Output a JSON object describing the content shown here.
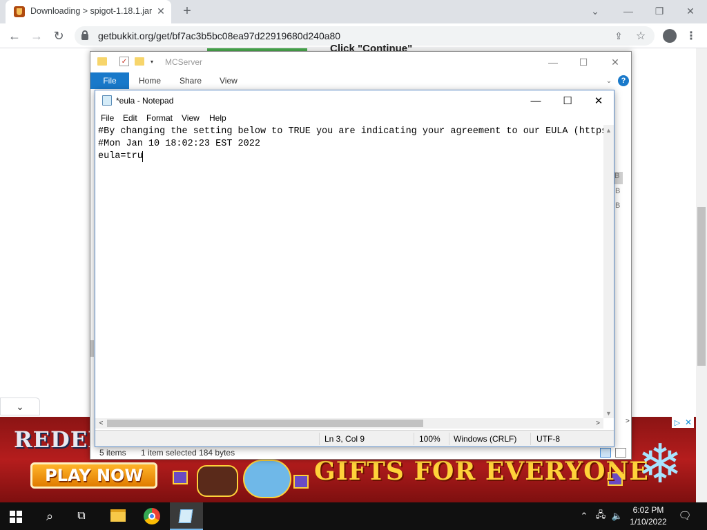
{
  "browser": {
    "tab_title": "Downloading > spigot-1.18.1.jar",
    "tab_close": "✕",
    "new_tab": "+",
    "url": "getbukkit.org/get/bf7ac3b5bc08ea97d22919680d240a80",
    "nav": {
      "back": "←",
      "forward": "→",
      "reload": "↻"
    },
    "window_controls": {
      "chevron": "⌄",
      "minimize": "—",
      "restore": "❐",
      "close": "✕"
    },
    "share": "⇪",
    "star": "☆",
    "menu": "⋮"
  },
  "page": {
    "background_text": "Click \"Continue\"",
    "download_chevron": "⌄"
  },
  "ad": {
    "brand_text": "REDEM",
    "play_now": "PLAY NOW",
    "headline": "GIFTS FOR EVERYONE",
    "snowflake": "❄",
    "choices": "▷",
    "close": "✕"
  },
  "explorer": {
    "title": "MCServer",
    "check": "✓",
    "dropdown": "▾",
    "controls": {
      "minimize": "—",
      "maximize": "☐",
      "close": "✕"
    },
    "ribbon": {
      "file": "File",
      "tabs": [
        "Home",
        "Share",
        "View"
      ],
      "chevron": "⌄",
      "help": "?"
    },
    "status": {
      "items": "5 items",
      "selected": "1 item selected  184 bytes"
    },
    "background_letters": [
      "B",
      "B",
      "B"
    ]
  },
  "notepad": {
    "title": "*eula - Notepad",
    "controls": {
      "minimize": "—",
      "maximize": "☐",
      "close": "✕"
    },
    "menu": [
      "File",
      "Edit",
      "Format",
      "View",
      "Help"
    ],
    "lines": [
      "#By changing the setting below to TRUE you are indicating your agreement to our EULA (https",
      "#Mon Jan 10 18:02:23 EST 2022",
      "eula=tru"
    ],
    "scroll": {
      "up": "▲",
      "down": "▼",
      "left": "<",
      "right": ">"
    },
    "status": {
      "position": "Ln 3, Col 9",
      "zoom": "100%",
      "line_ending": "Windows (CRLF)",
      "encoding": "UTF-8"
    }
  },
  "taskbar": {
    "search": "⌕",
    "task_view": "⧉",
    "tray_chevron": "⌃",
    "network": "🖧",
    "volume": "🔈",
    "time": "6:02 PM",
    "date": "1/10/2022",
    "notifications": "🗨"
  }
}
